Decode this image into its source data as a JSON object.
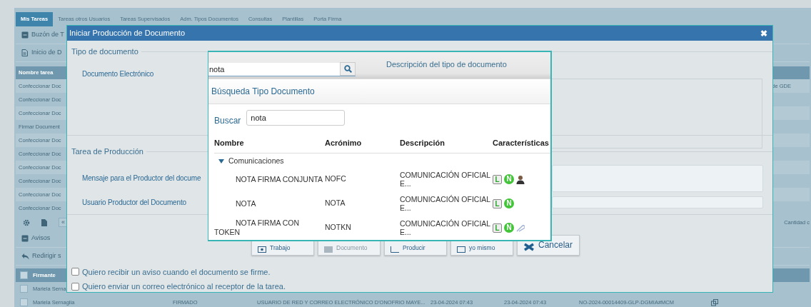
{
  "tabs": [
    {
      "label": "Mis Tareas",
      "selected": true
    },
    {
      "label": "Tareas otros Usuarios",
      "selected": false
    },
    {
      "label": "Tareas Supervisados",
      "selected": false
    },
    {
      "label": "Adm. Tipos Documentos",
      "selected": false
    },
    {
      "label": "Consultas",
      "selected": false
    },
    {
      "label": "Plantillas",
      "selected": false
    },
    {
      "label": "Porta Firma",
      "selected": false
    }
  ],
  "panels": [
    {
      "label": "Buzón de T"
    },
    {
      "label": "Inicio de D"
    }
  ],
  "tasks_table": {
    "columns": [
      "Nombre tarea"
    ],
    "rows": [
      {
        "column_1": "Confeccionar Doc",
        "column_2": "de GDE"
      },
      {
        "column_1": "Confeccionar Doc"
      },
      {
        "column_1": "Confeccionar Doc"
      },
      {
        "column_1": "Firmar Document"
      },
      {
        "column_1": "Confeccionar Doc"
      },
      {
        "column_1": "Confeccionar Doc"
      },
      {
        "column_1": "Confeccionar Doc"
      },
      {
        "column_1": "Confeccionar Doc"
      },
      {
        "column_1": "Confeccionar Doc"
      },
      {
        "column_1": "Confeccionar Doc"
      }
    ]
  },
  "pager": {
    "first": "«",
    "count_label": "Cantidad c"
  },
  "avisos": {
    "label": "Avisos"
  },
  "redirect": {
    "label": "Redirigir s"
  },
  "signers_table": {
    "all_checked": false,
    "columns": [
      "Firmante"
    ],
    "rows": [
      {
        "checked": false,
        "cells": [
          "Mariela Serna"
        ]
      },
      {
        "checked": false,
        "cells": [
          "Mariela Sernaglia",
          "FIRMADO",
          "USUARIO DE RED Y CORREO ELECTRÓNICO D'ONOFRIO MAYE...",
          "23-04-2024 07:43",
          "23-04-2024 07:43",
          "NO-2024-00014409-GLP-DGMIA#MCM"
        ]
      }
    ]
  },
  "modal": {
    "title": "Iniciar Producción de Documento",
    "close": "✖",
    "doc_type_legend": "Tipo de documento",
    "doc_type_label": "Documento Electrónico",
    "description_legend": "Descripción del tipo de documento",
    "production_legend": "Tarea de Producción",
    "message_label": "Mensaje para el Productor del docume",
    "user_label": "Usuario Productor del Documento",
    "buttons": [
      {
        "label": "Trabajo",
        "disabled": false
      },
      {
        "label": "Documento",
        "disabled": true
      },
      {
        "label": "Producir",
        "disabled": false
      },
      {
        "label": "yo mismo",
        "disabled": false
      },
      {
        "label": "Cancelar",
        "disabled": false
      }
    ],
    "checkboxes": [
      {
        "label": "Quiero recibir un aviso cuando el documento se firme.",
        "checked": false
      },
      {
        "label": "Quiero enviar un correo electrónico al receptor de la tarea.",
        "checked": false
      }
    ]
  },
  "dropdown": {
    "query": "nota",
    "title": "Búsqueda Tipo Documento",
    "search_label": "Buscar",
    "search_value": "nota",
    "columns": [
      "Nombre",
      "Acrónimo",
      "Descripción",
      "Características"
    ],
    "groups": [
      {
        "name": "Comunicaciones",
        "expanded": true,
        "rows": [
          {
            "name": "NOTA FIRMA CONJUNTA",
            "acronym": "NOFC",
            "description": "COMUNICACIÓN OFICIAL E...",
            "features": [
              {
                "kind": "badge",
                "letter": "L"
              },
              {
                "kind": "round",
                "letter": "N"
              },
              {
                "kind": "person"
              }
            ]
          },
          {
            "name": "NOTA",
            "acronym": "NOTA",
            "description": "COMUNICACIÓN OFICIAL E...",
            "features": [
              {
                "kind": "badge",
                "letter": "L"
              },
              {
                "kind": "round",
                "letter": "N"
              }
            ]
          },
          {
            "name": "NOTA FIRMA CON TOKEN",
            "acronym": "NOTKN",
            "description": "COMUNICACIÓN OFICIAL E...",
            "features": [
              {
                "kind": "badge",
                "letter": "L"
              },
              {
                "kind": "round",
                "letter": "N"
              },
              {
                "kind": "token"
              }
            ]
          }
        ]
      }
    ]
  }
}
